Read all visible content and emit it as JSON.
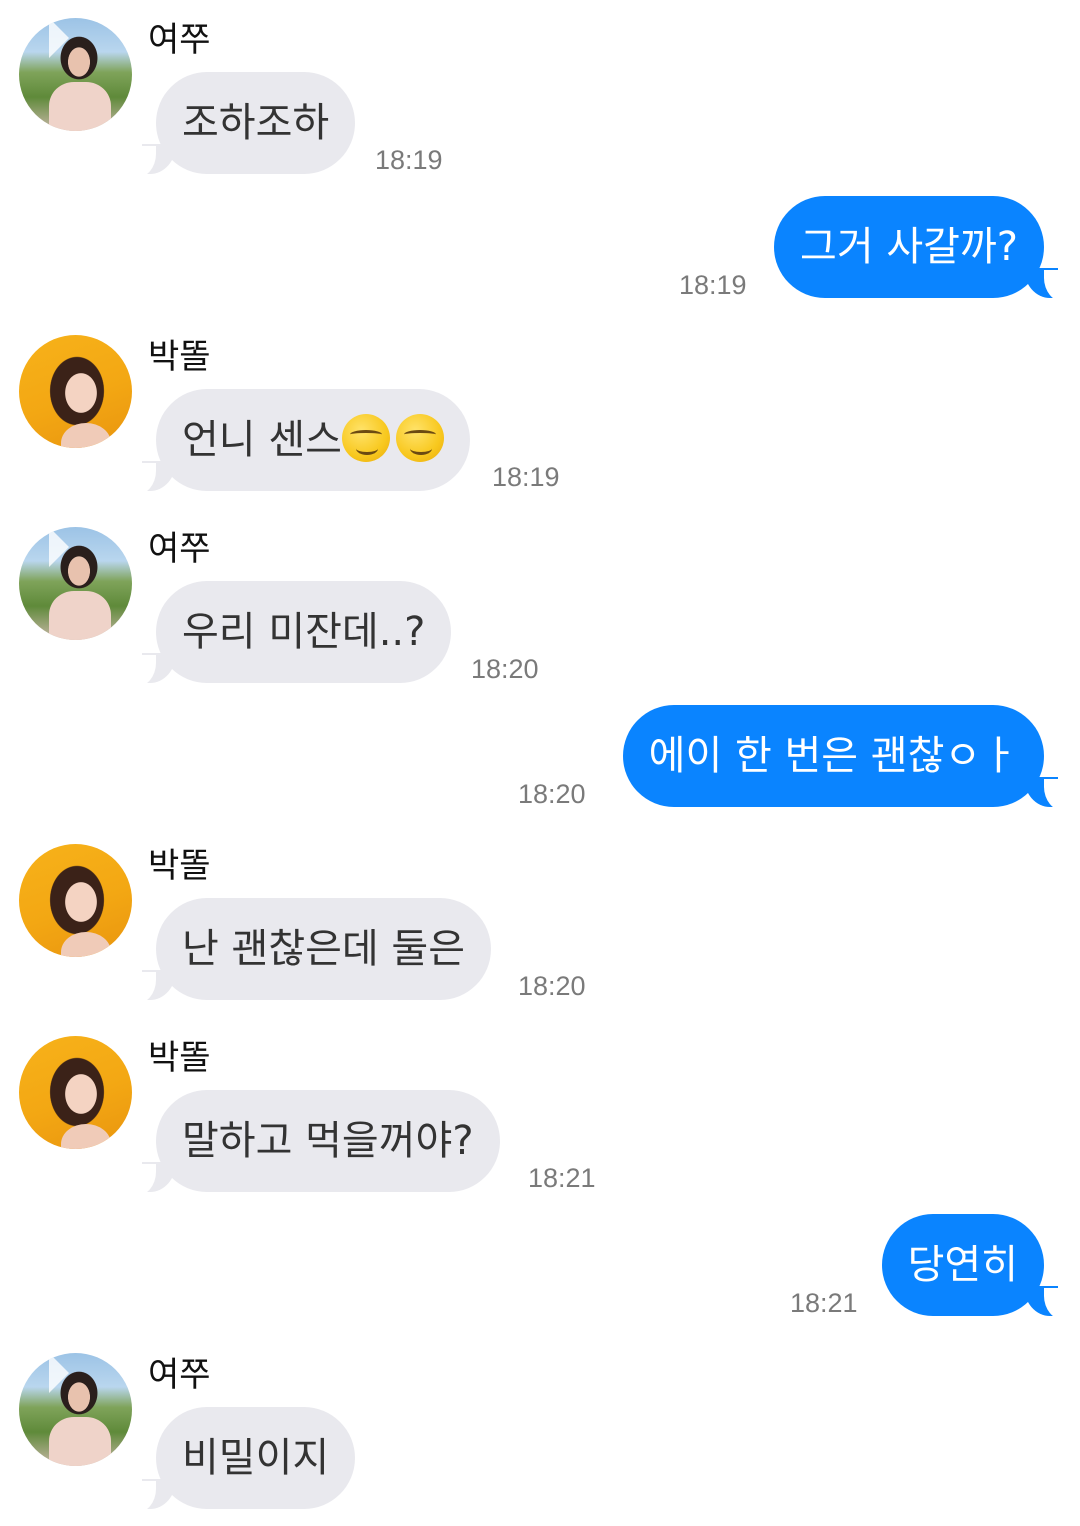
{
  "messages": [
    {
      "sender": "여쭈",
      "text": "조하조하",
      "time": "18:19"
    },
    {
      "text": "그거 사갈까?",
      "time": "18:19"
    },
    {
      "sender": "박똘",
      "text": "언니 센스",
      "emoji": [
        "smirking-face",
        "smirking-face"
      ],
      "time": "18:19"
    },
    {
      "sender": "여쭈",
      "text": "우리 미잔데..?",
      "time": "18:20"
    },
    {
      "text": "에이 한 번은 괜찮ㅇㅏ",
      "time": "18:20"
    },
    {
      "sender": "박똘",
      "text": "난 괜찮은데 둘은",
      "time": "18:20"
    },
    {
      "sender": "박똘",
      "text": "말하고 먹을꺼야?",
      "time": "18:21"
    },
    {
      "text": "당연히",
      "time": "18:21"
    },
    {
      "sender": "여쭈",
      "text": "비밀이지"
    }
  ],
  "colors": {
    "incoming_bubble": "#e9e9ee",
    "outgoing_bubble": "#0a84ff",
    "timestamp": "#7a7a7a"
  }
}
